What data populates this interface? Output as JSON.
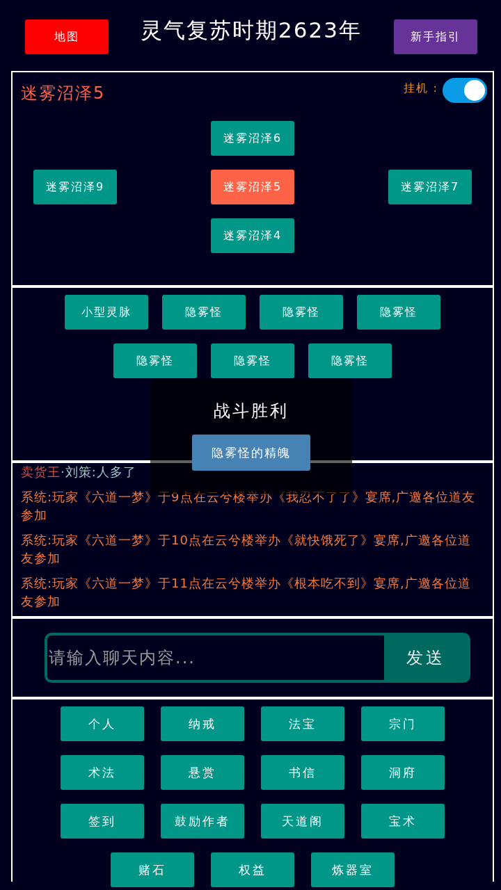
{
  "header": {
    "map_button": "地图",
    "title": "灵气复苏时期2623年",
    "guide_button": "新手指引"
  },
  "map": {
    "title": "迷雾沼泽5",
    "auto_battle": {
      "label": "挂机 :",
      "on": true
    },
    "rows": [
      {
        "center": {
          "label": "迷雾沼泽6",
          "selected": false
        }
      },
      {
        "left": {
          "label": "迷雾沼泽9",
          "selected": false
        },
        "center": {
          "label": "迷雾沼泽5",
          "selected": true
        },
        "right": {
          "label": "迷雾沼泽7",
          "selected": false
        }
      },
      {
        "center": {
          "label": "迷雾沼泽4",
          "selected": false
        }
      }
    ]
  },
  "encounters": {
    "targets": [
      "小型灵脉",
      "隐雾怪",
      "隐雾怪",
      "隐雾怪",
      "隐雾怪",
      "隐雾怪",
      "隐雾怪"
    ],
    "battle_result": {
      "title": "战斗胜利",
      "rewards": [
        "隐雾怪的精魄"
      ]
    }
  },
  "log": {
    "entries": [
      {
        "kind": "chat",
        "segments": [
          {
            "text": "卖货王",
            "color": "#c8504a"
          },
          {
            "text": "·刘策:人多了",
            "color": "#a4c4c8"
          }
        ]
      },
      {
        "kind": "system",
        "text": "系统:玩家《六道一梦》于9点在云兮楼举办《我忍不了了》宴席,广邀各位道友参加"
      },
      {
        "kind": "system",
        "text": "系统:玩家《六道一梦》于10点在云兮楼举办《就快饿死了》宴席,广邀各位道友参加"
      },
      {
        "kind": "system",
        "text": "系统:玩家《六道一梦》于11点在云兮楼举办《根本吃不到》宴席,广邀各位道友参加"
      }
    ]
  },
  "chat": {
    "placeholder": "请输入聊天内容...",
    "send_button": "发送"
  },
  "menu": {
    "items": [
      "个人",
      "纳戒",
      "法宝",
      "宗门",
      "术法",
      "悬赏",
      "书信",
      "洞府",
      "签到",
      "鼓励作者",
      "天道阁",
      "宝术",
      "赌石",
      "权益",
      "炼器室"
    ]
  }
}
